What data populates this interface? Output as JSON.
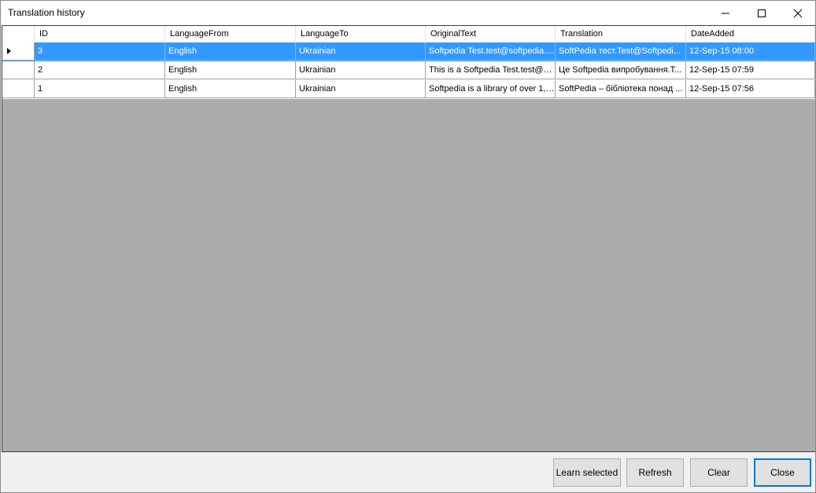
{
  "window": {
    "title": "Translation history"
  },
  "grid": {
    "columns": [
      "ID",
      "LanguageFrom",
      "LanguageTo",
      "OriginalText",
      "Translation",
      "DateAdded"
    ],
    "rows": [
      {
        "id": "3",
        "from": "English",
        "to": "Ukrainian",
        "original": "Softpedia Test.test@softpedia....",
        "translation": "SoftPedia тест.Test@Softpedi...",
        "date": "12-Sep-15 08:00"
      },
      {
        "id": "2",
        "from": "English",
        "to": "Ukrainian",
        "original": "This is a Softpedia Test.test@s...",
        "translation": "Це Softpedia випробування.T...",
        "date": "12-Sep-15 07:59"
      },
      {
        "id": "1",
        "from": "English",
        "to": "Ukrainian",
        "original": "Softpedia is a library of over 1,3...",
        "translation": "SoftPedia – бібліотека понад ...",
        "date": "12-Sep-15 07:56"
      }
    ],
    "selected_row": 0
  },
  "buttons": {
    "learn": "Learn selected",
    "refresh": "Refresh",
    "clear": "Clear",
    "close": "Close"
  },
  "colors": {
    "selection": "#3399ff",
    "empty_area": "#ababab",
    "default_button_border": "#0078d7"
  }
}
